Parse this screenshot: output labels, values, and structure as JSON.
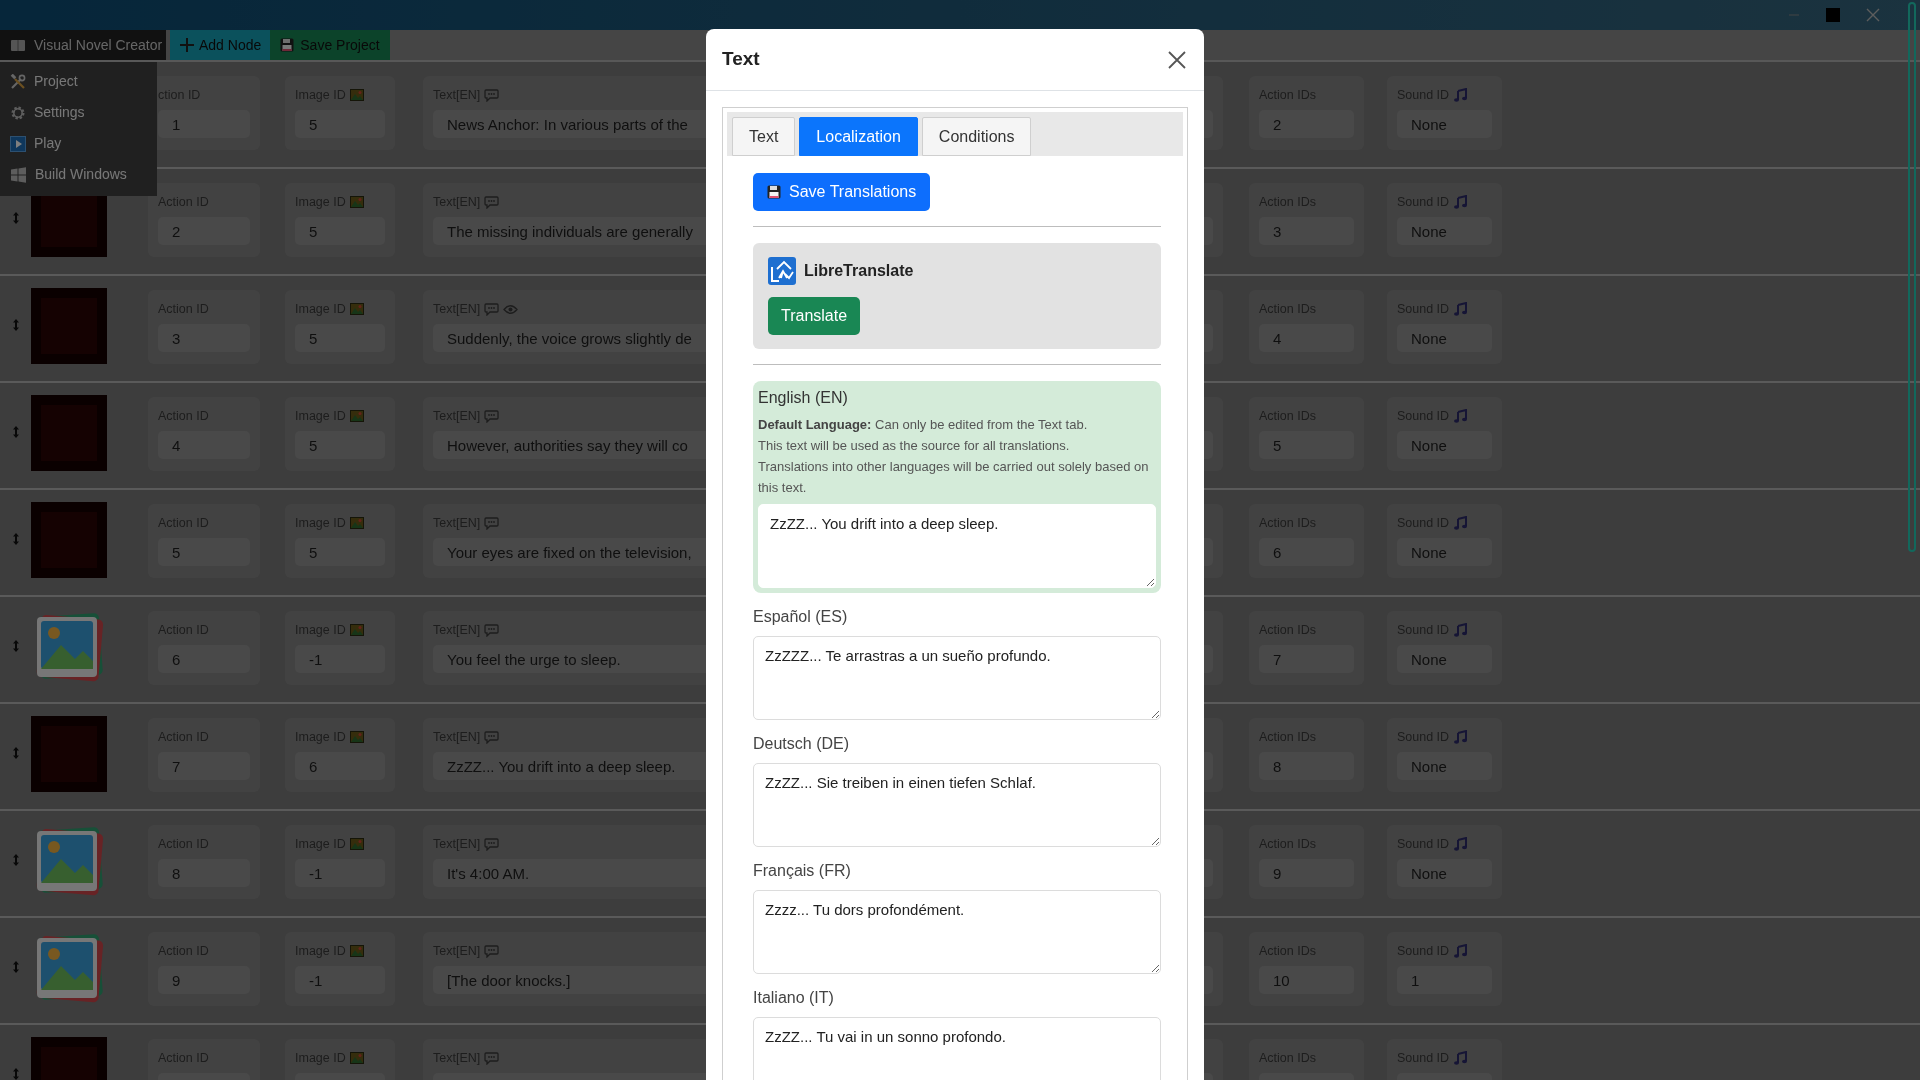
{
  "menu": {
    "app_menu": {
      "label": "Visual Novel Creator",
      "expanded": true,
      "items": [
        {
          "label": "Project",
          "kind": "tools"
        },
        {
          "label": "Settings",
          "kind": "gear"
        },
        {
          "label": "Play",
          "kind": "play"
        },
        {
          "label": "Build Windows",
          "kind": "build"
        }
      ]
    },
    "buttons": [
      {
        "label": "Add Node",
        "kind": "add"
      },
      {
        "label": "Save Project",
        "kind": "save"
      }
    ]
  },
  "nodes": [
    {
      "action_id_label": "ction ID",
      "action_id": "1",
      "image_id_label": "Image ID",
      "image_id": "5",
      "text_label": "Text[EN]",
      "eye": false,
      "text": "News Anchor: In various parts of the",
      "action_ids_label": "Action IDs",
      "action_ids": "2",
      "sound_id_label": "Sound ID",
      "sound_id": "None"
    },
    {
      "kind": "photo",
      "action_id_label": "Action ID",
      "action_id": "2",
      "image_id_label": "Image ID",
      "image_id": "5",
      "text_label": "Text[EN]",
      "eye": false,
      "text": "The missing individuals are generally",
      "action_ids_label": "Action IDs",
      "action_ids": "3",
      "sound_id_label": "Sound ID",
      "sound_id": "None"
    },
    {
      "kind": "photo",
      "action_id_label": "Action ID",
      "action_id": "3",
      "image_id_label": "Image ID",
      "image_id": "5",
      "text_label": "Text[EN]",
      "eye": true,
      "text": "Suddenly, the voice grows slightly de",
      "action_ids_label": "Action IDs",
      "action_ids": "4",
      "sound_id_label": "Sound ID",
      "sound_id": "None"
    },
    {
      "kind": "photo",
      "action_id_label": "Action ID",
      "action_id": "4",
      "image_id_label": "Image ID",
      "image_id": "5",
      "text_label": "Text[EN]",
      "eye": false,
      "text": "However, authorities say they will co",
      "action_ids_label": "Action IDs",
      "action_ids": "5",
      "sound_id_label": "Sound ID",
      "sound_id": "None"
    },
    {
      "kind": "photo",
      "action_id_label": "Action ID",
      "action_id": "5",
      "image_id_label": "Image ID",
      "image_id": "5",
      "text_label": "Text[EN]",
      "eye": false,
      "text": "Your eyes are fixed on the television,",
      "action_ids_label": "Action IDs",
      "action_ids": "6",
      "sound_id_label": "Sound ID",
      "sound_id": "None"
    },
    {
      "kind": "placeholder",
      "action_id_label": "Action ID",
      "action_id": "6",
      "image_id_label": "Image ID",
      "image_id": "-1",
      "text_label": "Text[EN]",
      "eye": false,
      "text": "You feel the urge to sleep.",
      "action_ids_label": "Action IDs",
      "action_ids": "7",
      "sound_id_label": "Sound ID",
      "sound_id": "None"
    },
    {
      "kind": "photo",
      "action_id_label": "Action ID",
      "action_id": "7",
      "image_id_label": "Image ID",
      "image_id": "6",
      "text_label": "Text[EN]",
      "eye": false,
      "text": "ZzZZ... You drift into a deep sleep.",
      "action_ids_label": "Action IDs",
      "action_ids": "8",
      "sound_id_label": "Sound ID",
      "sound_id": "None"
    },
    {
      "kind": "placeholder",
      "action_id_label": "Action ID",
      "action_id": "8",
      "image_id_label": "Image ID",
      "image_id": "-1",
      "text_label": "Text[EN]",
      "eye": false,
      "text": "It's 4:00 AM.",
      "action_ids_label": "Action IDs",
      "action_ids": "9",
      "sound_id_label": "Sound ID",
      "sound_id": "None"
    },
    {
      "kind": "placeholder",
      "action_id_label": "Action ID",
      "action_id": "9",
      "image_id_label": "Image ID",
      "image_id": "-1",
      "text_label": "Text[EN]",
      "eye": false,
      "text": "[The door knocks.]",
      "action_ids_label": "Action IDs",
      "action_ids": "10",
      "sound_id_label": "Sound ID",
      "sound_id": "1"
    },
    {
      "kind": "photo",
      "action_id_label": "Action ID",
      "image_id_label": "Image ID",
      "text_label": "Text[EN]",
      "eye": false,
      "action_ids_label": "Action IDs",
      "sound_id_label": "Sound ID"
    }
  ],
  "modal": {
    "title": "Text",
    "tabs": [
      {
        "label": "Text",
        "selected": false
      },
      {
        "label": "Localization",
        "selected": true
      },
      {
        "label": "Conditions",
        "selected": false
      }
    ],
    "save_button": "Save Translations",
    "translator": {
      "name": "LibreTranslate",
      "button": "Translate"
    },
    "languages": [
      {
        "label": "English (EN)",
        "default": true,
        "note": [
          "**Default Language:** Can only be edited from the Text tab.",
          "This text will be used as the source for all translations.",
          "Translations into other languages will be carried out solely based on this text."
        ],
        "value": "ZzZZ... You drift into a deep sleep."
      },
      {
        "label": "Español (ES)",
        "default": false,
        "value": "ZzZZZ... Te arrastras a un sueño profundo."
      },
      {
        "label": "Deutsch (DE)",
        "default": false,
        "value": "ZzZZ... Sie treiben in einen tiefen Schlaf."
      },
      {
        "label": "Français (FR)",
        "default": false,
        "value": "Zzzz... Tu dors profondément."
      },
      {
        "label": "Italiano (IT)",
        "default": false,
        "value": "ZzZZ... Tu vai in un sonno profondo."
      }
    ]
  }
}
